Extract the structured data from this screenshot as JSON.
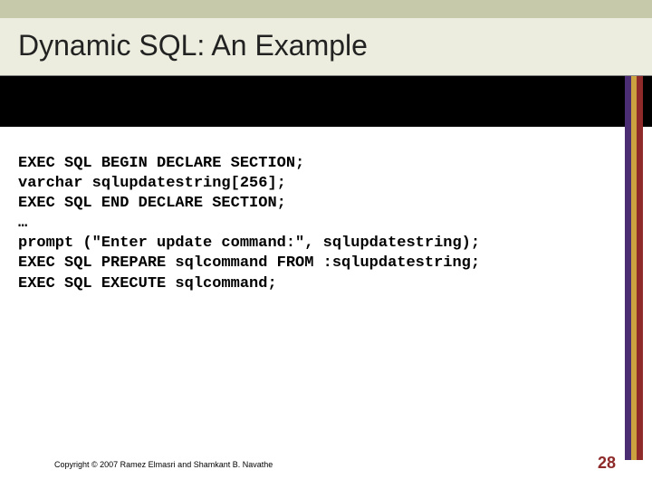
{
  "title": "Dynamic SQL: An Example",
  "code": {
    "l1": "EXEC SQL BEGIN DECLARE SECTION;",
    "l2": "varchar sqlupdatestring[256];",
    "l3": "EXEC SQL END DECLARE SECTION;",
    "l4": "…",
    "l5": "prompt (\"Enter update command:\", sqlupdatestring);",
    "l6": "EXEC SQL PREPARE sqlcommand FROM :sqlupdatestring;",
    "l7": "EXEC SQL EXECUTE sqlcommand;"
  },
  "footer": "Copyright © 2007 Ramez Elmasri and Shamkant B. Navathe",
  "page_number": "28",
  "accent_colors": {
    "header_green": "#c7c9ab",
    "title_bg": "#ecedde",
    "black": "#000000",
    "purple": "#4a2d73",
    "gold": "#caa23f",
    "red": "#8e2a2a"
  }
}
